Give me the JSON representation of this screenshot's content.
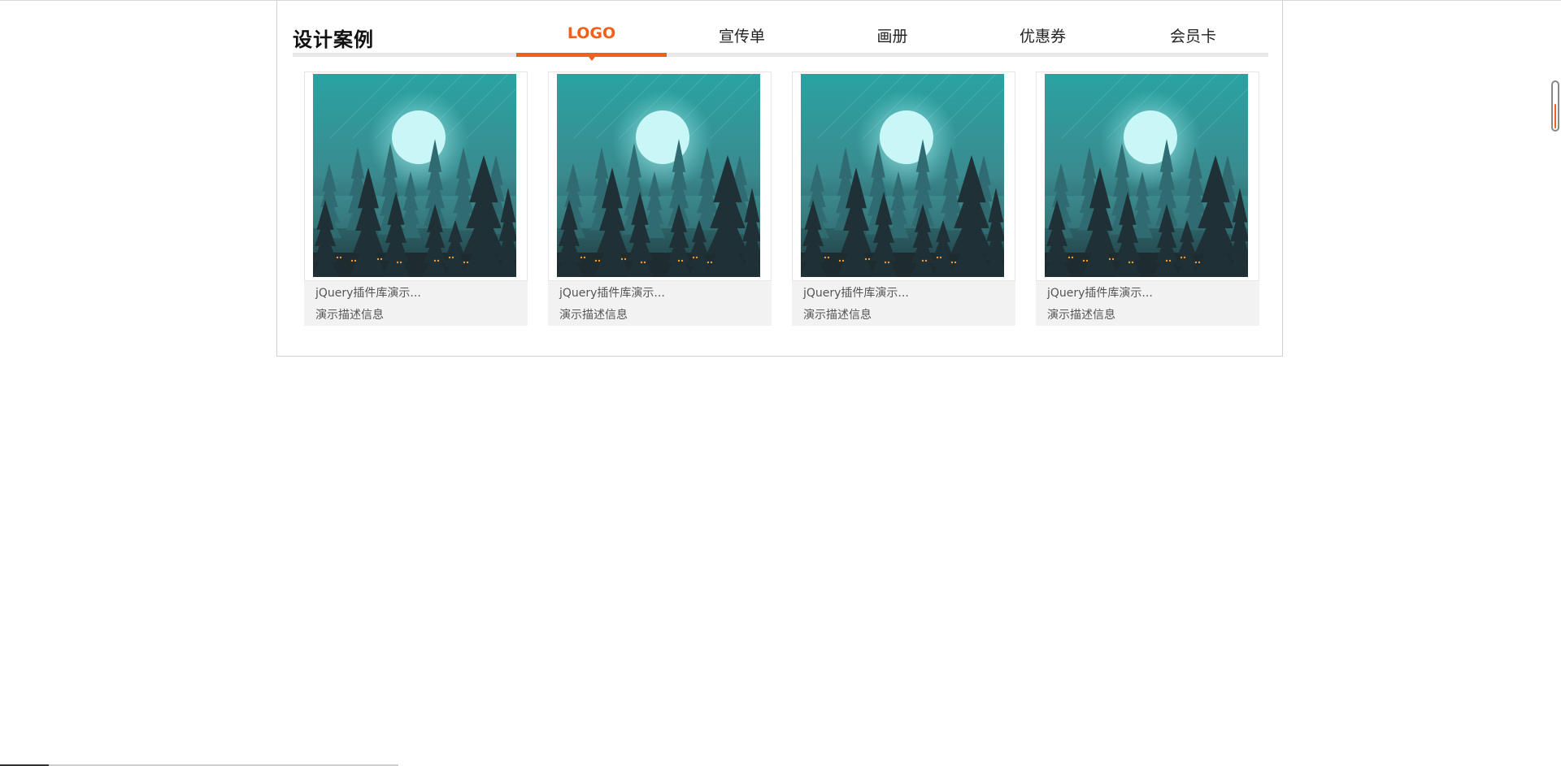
{
  "section": {
    "title": "设计案例"
  },
  "tabs": [
    {
      "label": "LOGO",
      "active": true
    },
    {
      "label": "宣传单",
      "active": false
    },
    {
      "label": "画册",
      "active": false
    },
    {
      "label": "优惠券",
      "active": false
    },
    {
      "label": "会员卡",
      "active": false
    }
  ],
  "cards": [
    {
      "title": "jQuery插件库演示...",
      "desc": "演示描述信息",
      "image": "moonlit-forest-illustration"
    },
    {
      "title": "jQuery插件库演示...",
      "desc": "演示描述信息",
      "image": "moonlit-forest-illustration"
    },
    {
      "title": "jQuery插件库演示...",
      "desc": "演示描述信息",
      "image": "moonlit-forest-illustration"
    },
    {
      "title": "jQuery插件库演示...",
      "desc": "演示描述信息",
      "image": "moonlit-forest-illustration"
    }
  ],
  "scroll_indicator": {
    "fill_fraction": 0.55
  },
  "colors": {
    "accent": "#f0601a",
    "text": "#222222",
    "muted_text": "#555555",
    "card_bg": "#f2f2f2",
    "rule": "#e8e8e8"
  }
}
